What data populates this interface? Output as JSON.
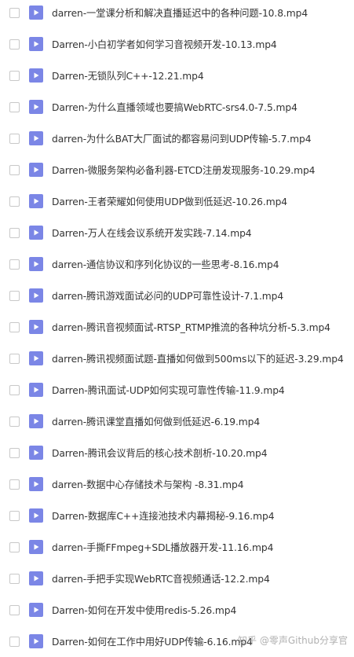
{
  "colors": {
    "icon_bg": "#7b86e6",
    "text": "#333333",
    "checkbox_border": "#c8c8c8"
  },
  "files": [
    {
      "name": "darren-一堂课分析和解决直播延迟中的各种问题-10.8.mp4",
      "icon": "video-file-icon"
    },
    {
      "name": "Darren-小白初学者如何学习音视频开发-10.13.mp4",
      "icon": "video-file-icon"
    },
    {
      "name": "Darren-无锁队列C++-12.21.mp4",
      "icon": "video-file-icon"
    },
    {
      "name": "Darren-为什么直播领域也要搞WebRTC-srs4.0-7.5.mp4",
      "icon": "video-file-icon"
    },
    {
      "name": "darren-为什么BAT大厂面试的都容易问到UDP传输-5.7.mp4",
      "icon": "video-file-icon"
    },
    {
      "name": "Darren-微服务架构必备利器-ETCD注册发现服务-10.29.mp4",
      "icon": "video-file-icon"
    },
    {
      "name": "Darren-王者荣耀如何使用UDP做到低延迟-10.26.mp4",
      "icon": "video-file-icon"
    },
    {
      "name": "Darren-万人在线会议系统开发实践-7.14.mp4",
      "icon": "video-file-icon"
    },
    {
      "name": "darren-通信协议和序列化协议的一些思考-8.16.mp4",
      "icon": "video-file-icon"
    },
    {
      "name": "darren-腾讯游戏面试必问的UDP可靠性设计-7.1.mp4",
      "icon": "video-file-icon"
    },
    {
      "name": "darren-腾讯音视频面试-RTSP_RTMP推流的各种坑分析-5.3.mp4",
      "icon": "video-file-icon"
    },
    {
      "name": "darren-腾讯视频面试题-直播如何做到500ms以下的延迟-3.29.mp4",
      "icon": "video-file-icon"
    },
    {
      "name": "Darren-腾讯面试-UDP如何实现可靠性传输-11.9.mp4",
      "icon": "video-file-icon"
    },
    {
      "name": "darren-腾讯课堂直播如何做到低延迟-6.19.mp4",
      "icon": "video-file-icon"
    },
    {
      "name": "Darren-腾讯会议背后的核心技术剖析-10.20.mp4",
      "icon": "video-file-icon"
    },
    {
      "name": "darren-数据中心存储技术与架构 -8.31.mp4",
      "icon": "video-file-icon"
    },
    {
      "name": "Darren-数据库C++连接池技术内幕揭秘-9.16.mp4",
      "icon": "video-file-icon"
    },
    {
      "name": "darren-手撕FFmpeg+SDL播放器开发-11.16.mp4",
      "icon": "video-file-icon"
    },
    {
      "name": "darren-手把手实现WebRTC音视频通话-12.2.mp4",
      "icon": "video-file-icon"
    },
    {
      "name": "Darren-如何在开发中使用redis-5.26.mp4",
      "icon": "video-file-icon"
    },
    {
      "name": "Darren-如何在工作中用好UDP传输-6.16.mp4",
      "icon": "video-file-icon"
    }
  ],
  "watermark": {
    "text": "知乎 @零声Github分享官"
  }
}
